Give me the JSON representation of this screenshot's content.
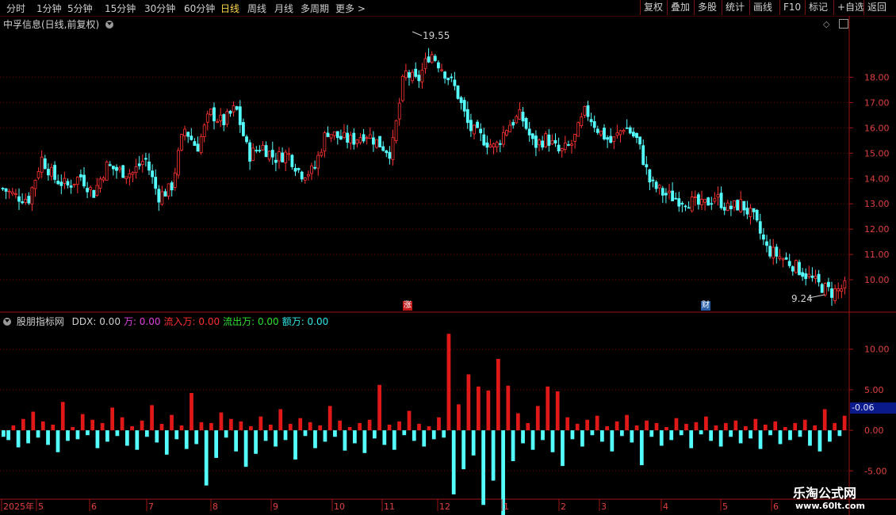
{
  "toolbar": {
    "periods": [
      {
        "label": "分时",
        "active": false
      },
      {
        "label": "1分钟",
        "active": false
      },
      {
        "label": "5分钟",
        "active": false
      },
      {
        "label": "15分钟",
        "active": false
      },
      {
        "label": "30分钟",
        "active": false
      },
      {
        "label": "60分钟",
        "active": false
      },
      {
        "label": "日线",
        "active": true
      },
      {
        "label": "周线",
        "active": false
      },
      {
        "label": "月线",
        "active": false
      },
      {
        "label": "多周期",
        "active": false
      },
      {
        "label": "更多",
        "active": false
      }
    ],
    "right_buttons": [
      "复权",
      "叠加",
      "多股",
      "统计",
      "画线",
      "F10",
      "标记",
      "+自选",
      "返回"
    ]
  },
  "main_panel": {
    "title": "中孚信息(日线,前复权)",
    "high_label": "19.55",
    "low_label": "9.24",
    "event_markers": [
      {
        "label": "涨",
        "color": "#c41a1a"
      },
      {
        "label": "财",
        "color": "#2a5ea8"
      }
    ],
    "y_ticks": [
      "18.00",
      "17.00",
      "16.00",
      "15.00",
      "14.00",
      "13.00",
      "12.00",
      "11.00",
      "10.00"
    ]
  },
  "indicator_panel": {
    "name": "股朋指标网",
    "fields": [
      {
        "label": "DDX:",
        "value": "0.00",
        "color": "#d0d0d0"
      },
      {
        "label": "万:",
        "value": "0.00",
        "color": "#e040e0"
      },
      {
        "label": "流入万:",
        "value": "0.00",
        "color": "#ff3030"
      },
      {
        "label": "流出万:",
        "value": "0.00",
        "color": "#30e030"
      },
      {
        "label": "额万:",
        "value": "0.00",
        "color": "#30e8e8"
      }
    ],
    "y_ticks": [
      "10.00",
      "5.00",
      "0.00",
      "-5.00"
    ],
    "current_value": "-0.06"
  },
  "time_axis": {
    "labels": [
      "2025年",
      "5",
      "6",
      "7",
      "8",
      "9",
      "10",
      "11",
      "12",
      "1",
      "2",
      "3",
      "4",
      "5",
      "6"
    ]
  },
  "watermark": {
    "title": "乐淘公式网",
    "url": "www.60lt.com"
  },
  "colors": {
    "up": "#ff3232",
    "down": "#54ffff",
    "grid": "#7a0000",
    "axis": "#a01414"
  },
  "chart_data": [
    {
      "type": "candlestick",
      "title": "中孚信息(日线,前复权)",
      "y_range": [
        9.0,
        19.8
      ],
      "months": [
        "2025-04",
        "2025-05",
        "2025-06",
        "2025-07",
        "2025-08",
        "2025-09",
        "2025-10",
        "2025-11",
        "2025-12",
        "2026-01",
        "2026-02",
        "2026-03",
        "2026-04",
        "2026-05",
        "2026-06"
      ],
      "close_trend": [
        13.6,
        13.3,
        13.2,
        14.8,
        14.0,
        13.7,
        14.1,
        13.4,
        14.5,
        14.3,
        14.2,
        14.8,
        13.3,
        13.6,
        16.0,
        15.2,
        16.6,
        16.2,
        16.8,
        14.9,
        15.3,
        14.8,
        15.0,
        14.2,
        14.3,
        15.9,
        15.6,
        15.5,
        15.8,
        15.4,
        15.0,
        18.2,
        17.8,
        19.0,
        18.3,
        17.5,
        16.0,
        15.6,
        15.2,
        16.1,
        16.5,
        15.3,
        15.6,
        15.0,
        15.4,
        16.7,
        15.9,
        15.4,
        16.1,
        15.5,
        13.8,
        13.4,
        13.2,
        13.1,
        12.9,
        13.3,
        12.8,
        13.0,
        12.4,
        11.2,
        10.9,
        10.6,
        10.2,
        9.8,
        9.5,
        9.7
      ],
      "high": 19.55,
      "low": 9.24
    },
    {
      "type": "bar",
      "title": "股朋指标网",
      "y_range": [
        -8,
        13
      ],
      "series": [
        {
          "name": "DDX",
          "values": [
            -0.8,
            -1.2,
            0.6,
            -2.1,
            1.4,
            -1.6,
            2.3,
            -0.9,
            1.1,
            -1.8,
            0.7,
            -2.7,
            3.5,
            -1.3,
            0.4,
            -1.1,
            2.0,
            -0.6,
            1.3,
            -2.2,
            0.9,
            -1.4,
            2.8,
            -0.7,
            1.6,
            -1.9,
            0.5,
            -2.4,
            1.2,
            -0.8,
            3.1,
            -1.5,
            0.8,
            -3.0,
            1.9,
            -1.1,
            0.6,
            -2.3,
            4.6,
            -1.7,
            1.0,
            -6.8,
            0.9,
            -3.4,
            2.2,
            -0.9,
            1.4,
            -2.6,
            1.1,
            -4.5,
            0.5,
            -2.9,
            1.7,
            -1.3,
            0.7,
            -2.0,
            2.6,
            -1.2,
            0.8,
            -3.6,
            1.5,
            -0.7,
            1.0,
            -2.2,
            0.6,
            -1.4,
            3.0,
            -0.8,
            1.2,
            -2.5,
            0.4,
            -1.6,
            0.9,
            -2.8,
            1.3,
            -1.0,
            5.6,
            -1.8,
            0.7,
            -2.4,
            1.1,
            -0.6,
            2.4,
            -1.3,
            0.8,
            -2.0,
            0.5,
            -1.1,
            1.6,
            -0.9,
            11.9,
            -7.9,
            3.2,
            -4.8,
            6.9,
            -3.1,
            5.4,
            -9.2,
            4.9,
            -6.2,
            8.8,
            -12.1,
            5.5,
            -3.8,
            2.1,
            -1.6,
            0.9,
            -2.4,
            3.0,
            -1.2,
            5.4,
            -2.7,
            4.8,
            -4.4,
            1.6,
            -1.1,
            0.8,
            -2.0,
            1.3,
            -0.6,
            1.8,
            -1.4,
            0.5,
            -2.6,
            1.1,
            -0.7,
            1.9,
            -1.5,
            0.6,
            -4.3,
            1.2,
            -0.8,
            0.9,
            -1.9,
            0.4,
            -1.2,
            1.5,
            -0.6,
            0.8,
            -2.2,
            1.0,
            -0.5,
            1.7,
            -1.3,
            0.6,
            -2.0,
            0.9,
            -0.8,
            1.2,
            -1.6,
            0.5,
            -1.0,
            1.4,
            -2.3,
            0.7,
            -0.6,
            1.1,
            -1.7,
            0.4,
            -1.2,
            0.9,
            -0.8,
            1.3,
            -1.9,
            0.6,
            -2.6,
            2.6,
            -1.4,
            0.9,
            -0.7,
            1.8
          ]
        }
      ]
    }
  ]
}
